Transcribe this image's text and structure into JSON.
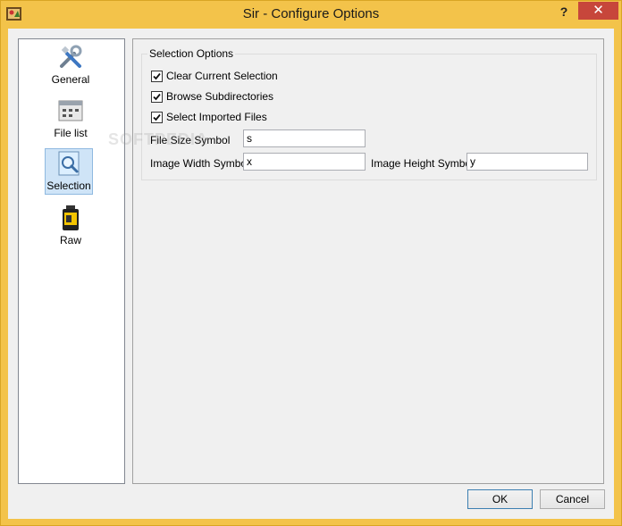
{
  "window": {
    "title": "Sir - Configure Options",
    "help_label": "?",
    "close_label": "✕"
  },
  "nav": {
    "items": [
      {
        "label": "General",
        "icon": "tools-icon"
      },
      {
        "label": "File list",
        "icon": "file-list-icon"
      },
      {
        "label": "Selection",
        "icon": "selection-icon",
        "selected": true
      },
      {
        "label": "Raw",
        "icon": "film-canister-icon"
      }
    ]
  },
  "selection_options": {
    "title": "Selection Options",
    "clear_current_selection": {
      "label": "Clear Current Selection",
      "checked": true
    },
    "browse_subdirectories": {
      "label": "Browse Subdirectories",
      "checked": true
    },
    "select_imported_files": {
      "label": "Select Imported Files",
      "checked": true
    },
    "file_size_symbol": {
      "label": "File Size Symbol",
      "value": "s"
    },
    "image_width_symbol": {
      "label": "Image Width Symbol",
      "value": "x"
    },
    "image_height_symbol": {
      "label": "Image Height Symbol",
      "value": "y"
    }
  },
  "buttons": {
    "ok": "OK",
    "cancel": "Cancel"
  },
  "watermark": "SOFTPEDIA",
  "colors": {
    "titlebar": "#f3c34a",
    "close": "#c7463b",
    "selected": "#cfe4f7"
  }
}
